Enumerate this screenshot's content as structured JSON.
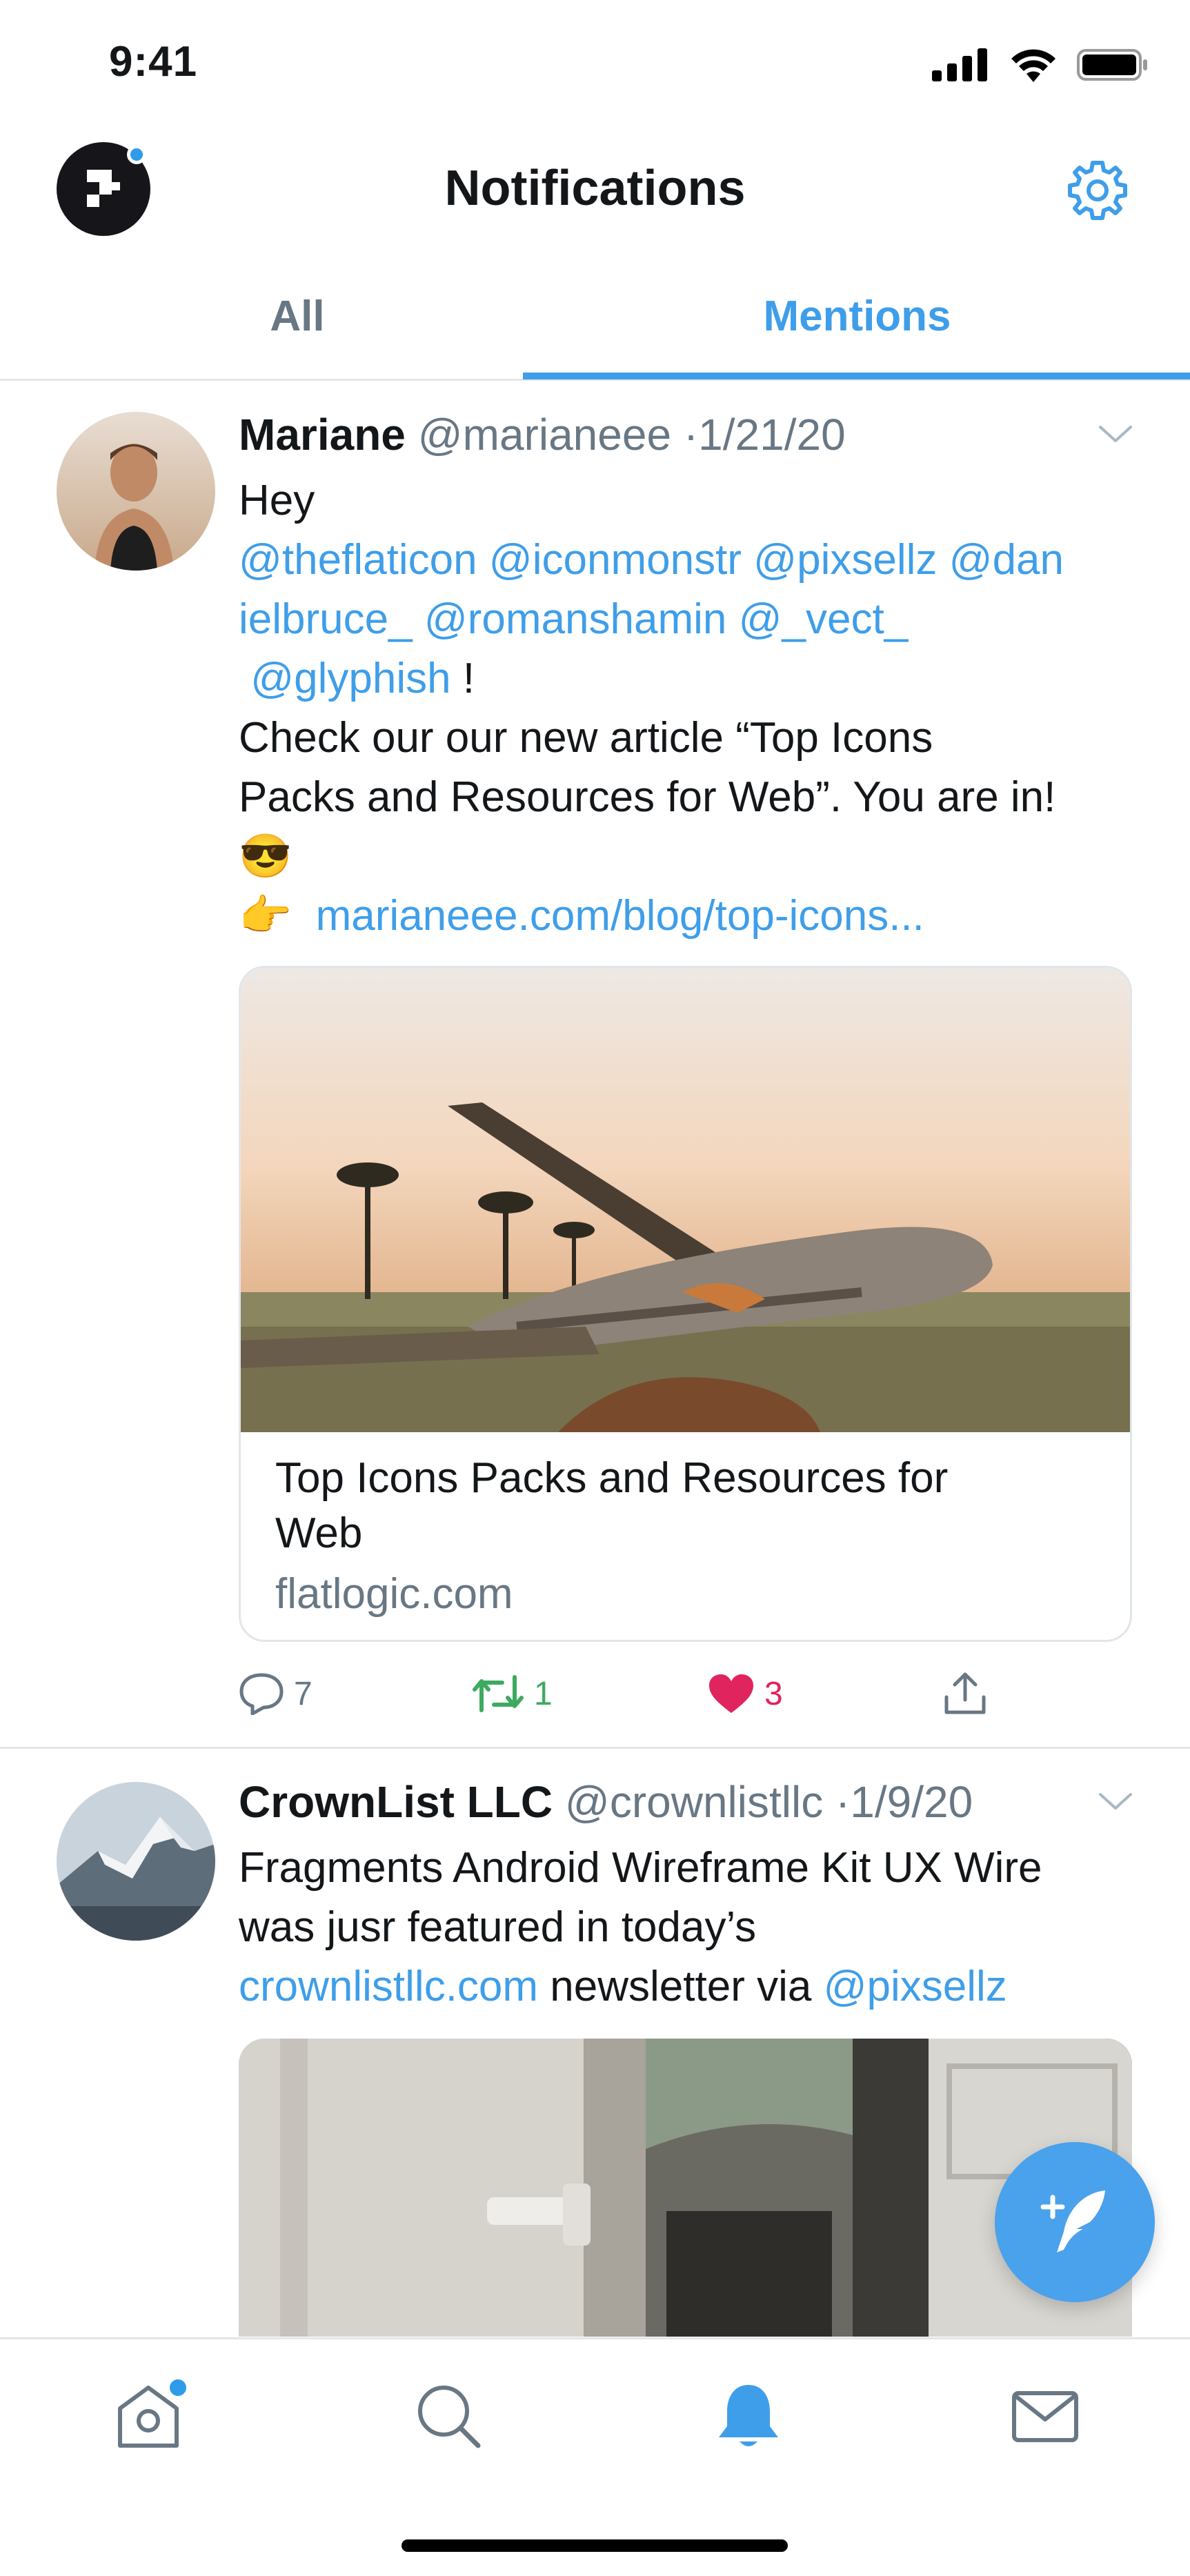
{
  "status_bar": {
    "time": "9:41"
  },
  "header": {
    "title": "Notifications"
  },
  "tabs": [
    {
      "label": "All",
      "active": false
    },
    {
      "label": "Mentions",
      "active": true
    }
  ],
  "colors": {
    "accent": "#3f9ee9",
    "text": "#14171a",
    "muted": "#687784",
    "retweet": "#3daa60",
    "like": "#e0245e"
  },
  "tweets": [
    {
      "author": "Mariane",
      "handle": "@marianeee",
      "date": "1/21/20",
      "greeting": "Hey",
      "mentions_line1": "@theflaticon @iconmonstr @pixsellz @dan",
      "mentions_line2": "ielbruce_ @romanshamin @_vect_",
      "mentions_line3": "@glyphish",
      "exclaim": "!",
      "text_line1": "Check our our new article “Top Icons",
      "text_line2": "Packs and Resources for Web”. You are in!",
      "emoji_sunglasses": "😎",
      "emoji_point": "👉",
      "link": "marianeee.com/blog/top-icons...",
      "card": {
        "title_line1": "Top Icons Packs and Resources for",
        "title_line2": "Web",
        "domain": "flatlogic.com"
      },
      "actions": {
        "replies": "7",
        "retweets": "1",
        "likes": "3"
      }
    },
    {
      "author": "CrownList LLC",
      "handle": "@crownlistllc",
      "date": "1/9/20",
      "text_line1": "Fragments Android Wireframe Kit  UX Wire",
      "text_line2": "was jusr featured in today’s",
      "link": "crownlistllc.com",
      "text_mid": " newsletter via ",
      "mention": "@pixsellz"
    }
  ],
  "icons": {
    "settings": "gear-icon",
    "fab": "compose-tweet-icon",
    "nav": [
      "home-icon",
      "search-icon",
      "bell-icon",
      "mail-icon"
    ]
  }
}
